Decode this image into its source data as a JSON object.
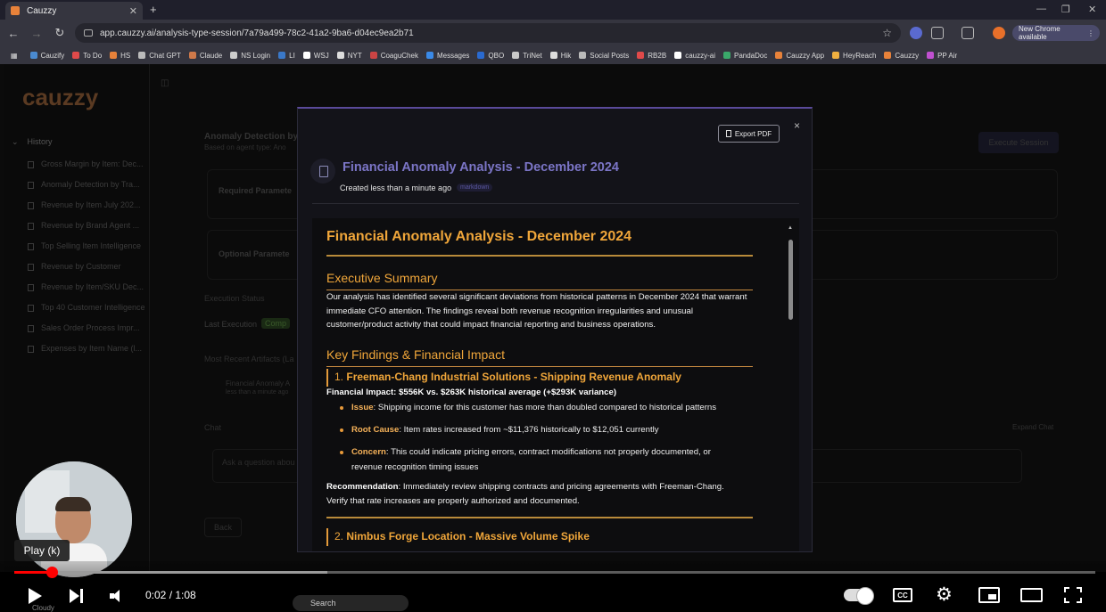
{
  "browser": {
    "tab_title": "Cauzzy",
    "url": "app.cauzzy.ai/analysis-type-session/7a79a499-78c2-41a2-9ba6-d04ec9ea2b71",
    "new_chrome_label": "New Chrome available",
    "bookmarks": [
      "Cauzify",
      "To Do",
      "HS",
      "Chat GPT",
      "Claude",
      "NS Login",
      "LI",
      "WSJ",
      "NYT",
      "CoaguChek",
      "Messages",
      "QBO",
      "TriNet",
      "Hik",
      "Social Posts",
      "RB2B",
      "cauzzy-ai",
      "PandaDoc",
      "Cauzzy App",
      "HeyReach",
      "Cauzzy",
      "PP Air"
    ]
  },
  "app": {
    "logo": "cauzzy",
    "history_label": "History",
    "history_items": [
      "Gross Margin by Item: Dec...",
      "Anomaly Detection by Tra...",
      "Revenue by Item July 202...",
      "Revenue by Brand Agent ...",
      "Top Selling Item Intelligence",
      "Revenue by Customer",
      "Revenue by Item/SKU Dec...",
      "Top 40 Customer Intelligence",
      "Sales Order Process Impr...",
      "Expenses by Item Name (l..."
    ],
    "page_title": "Anomaly Detection by",
    "page_subtitle": "Based on agent type: Ano",
    "execute_button": "Execute Session",
    "required_params": "Required Paramete",
    "optional_params": "Optional Paramete",
    "execution_status": "Execution Status",
    "last_execution": "Last Execution",
    "last_execution_badge": "Comp",
    "recent_artifacts": "Most Recent Artifacts (La",
    "artifact_name": "Financial Anomaly A",
    "artifact_time": "less than a minute ago",
    "chat_label": "Chat",
    "expand_chat": "Expand Chat",
    "chat_placeholder": "Ask a question abou",
    "back_button": "Back"
  },
  "modal": {
    "export_label": "Export PDF",
    "close": "×",
    "title": "Financial Anomaly Analysis - December 2024",
    "created": "Created less than a minute ago",
    "badge": "markdown",
    "report": {
      "title": "Financial Anomaly Analysis - December 2024",
      "exec_heading": "Executive Summary",
      "exec_text": "Our analysis has identified several significant deviations from historical patterns in December 2024 that warrant immediate CFO attention. The findings reveal both revenue recognition irregularities and unusual customer/product activity that could impact financial reporting and business operations.",
      "findings_heading": "Key Findings & Financial Impact",
      "finding1": {
        "num": "1.",
        "title": "Freeman-Chang Industrial Solutions - Shipping Revenue Anomaly",
        "impact": "Financial Impact: $556K vs. $263K historical average (+$293K variance)",
        "bullets": [
          {
            "label": "Issue",
            "text": ": Shipping income for this customer has more than doubled compared to historical patterns"
          },
          {
            "label": "Root Cause",
            "text": ": Item rates increased from ~$11,376 historically to $12,051 currently"
          },
          {
            "label": "Concern",
            "text": ": This could indicate pricing errors, contract modifications not properly documented, or revenue recognition timing issues"
          }
        ],
        "rec_label": "Recommendation",
        "rec_text": ": Immediately review shipping contracts and pricing agreements with Freeman-Chang. Verify that rate increases are properly authorized and documented."
      },
      "finding2": {
        "num": "2.",
        "title": "Nimbus Forge Location - Massive Volume Spike"
      }
    }
  },
  "player": {
    "tooltip": "Play (k)",
    "time": "0:02 / 1:08",
    "progress_played": 0.035,
    "progress_buffered": 0.29,
    "cc_label": "CC",
    "search_label": "Search",
    "weather": "Cloudy"
  }
}
